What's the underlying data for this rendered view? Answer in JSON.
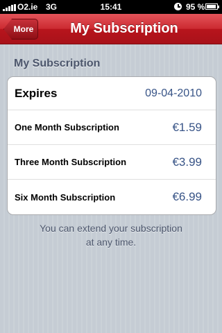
{
  "status_bar": {
    "carrier": "O2.ie",
    "network": "3G",
    "time": "15:41",
    "battery_percent": "95 %",
    "battery_level": 0.95
  },
  "nav": {
    "back_label": "More",
    "title": "My Subscription"
  },
  "section": {
    "header": "My Subscription",
    "rows": [
      {
        "label": "Expires",
        "value": "09-04-2010"
      },
      {
        "label": "One Month Subscription",
        "value": "€1.59"
      },
      {
        "label": "Three Month Subscription",
        "value": "€3.99"
      },
      {
        "label": "Six Month Subscription",
        "value": "€6.99"
      }
    ]
  },
  "footer": {
    "line1": "You can extend your subscription",
    "line2": "at any time."
  },
  "colors": {
    "nav_red": "#cc2a31",
    "value_blue": "#385487",
    "header_gray": "#4c566c"
  }
}
